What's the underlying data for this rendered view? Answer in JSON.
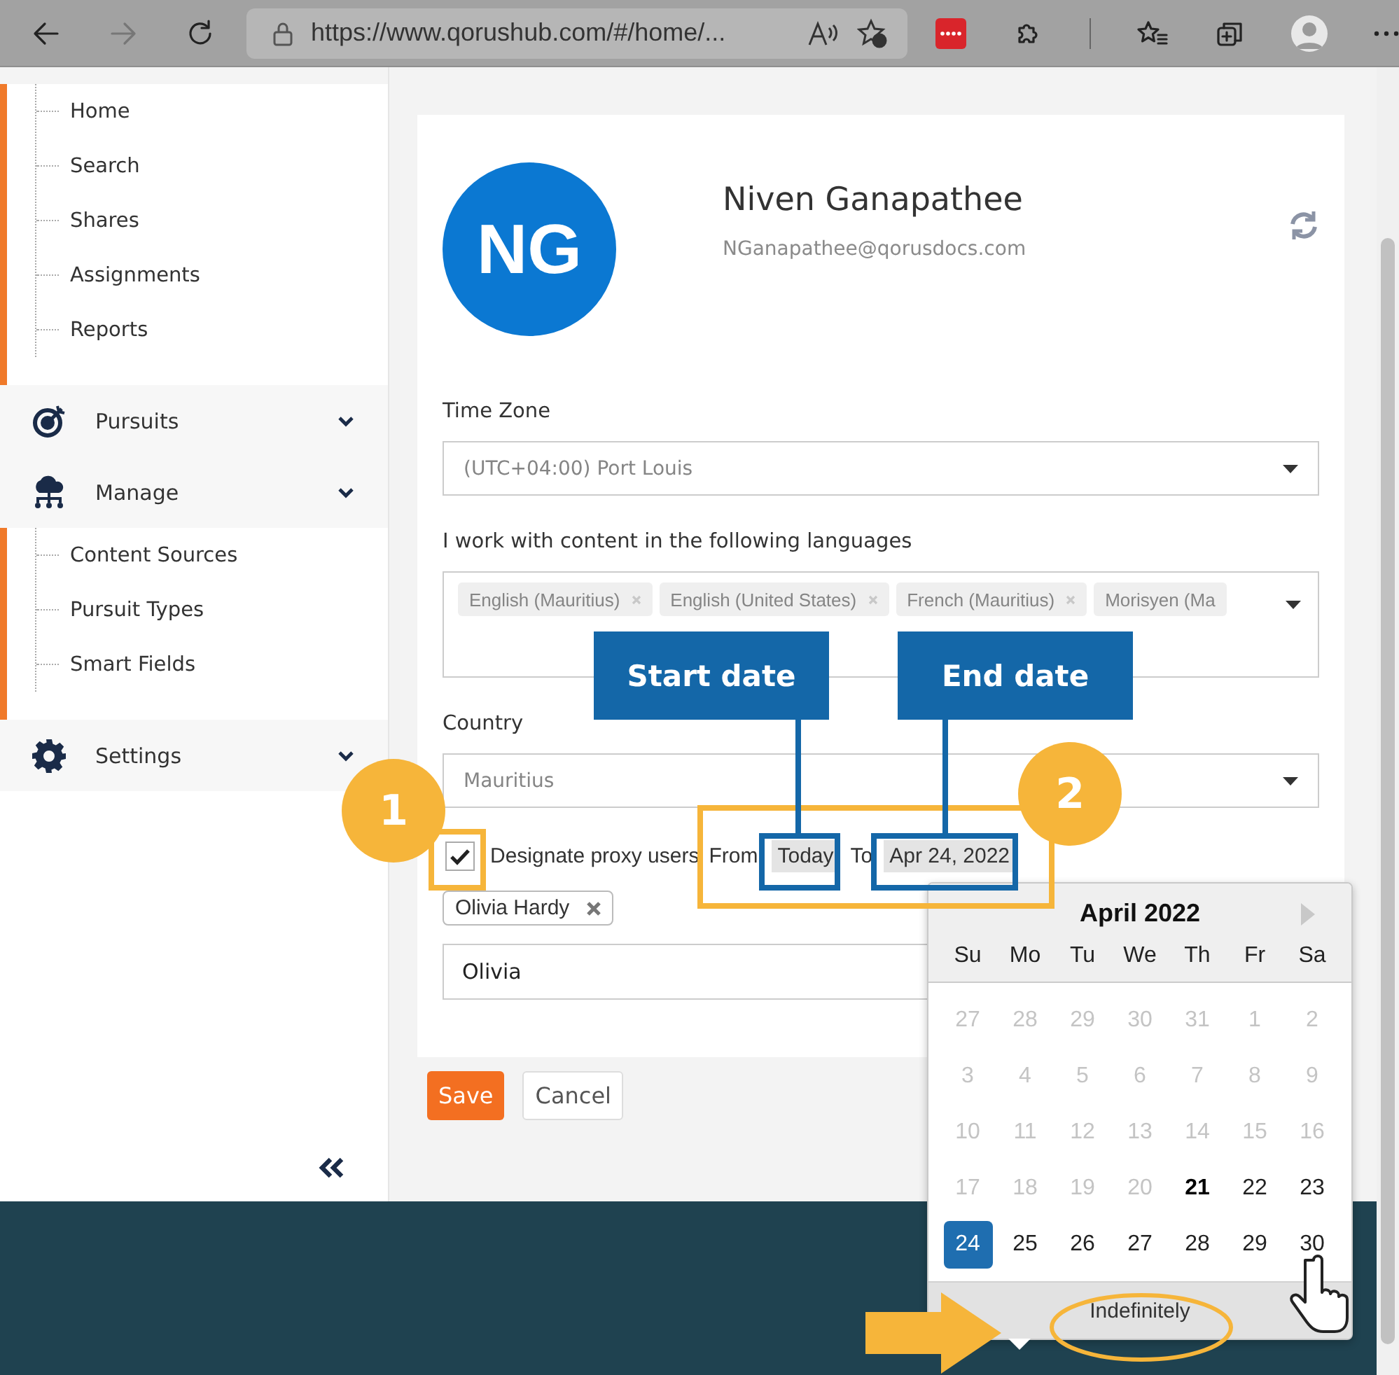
{
  "browser": {
    "url": "https://www.qorushub.com/#/home/..."
  },
  "sidebar": {
    "items": [
      {
        "kind": "links",
        "children": [
          {
            "label": "Home"
          },
          {
            "label": "Search"
          },
          {
            "label": "Shares"
          },
          {
            "label": "Assignments"
          },
          {
            "label": "Reports"
          }
        ]
      },
      {
        "kind": "group",
        "label": "Pursuits"
      },
      {
        "kind": "group",
        "label": "Manage"
      },
      {
        "kind": "links",
        "children": [
          {
            "label": "Content Sources"
          },
          {
            "label": "Pursuit Types"
          },
          {
            "label": "Smart Fields"
          }
        ]
      },
      {
        "kind": "group",
        "label": "Settings"
      }
    ]
  },
  "profile": {
    "initials": "NG",
    "name": "Niven Ganapathee",
    "email": "NGanapathee@qorusdocs.com"
  },
  "form": {
    "time_zone": {
      "label": "Time Zone",
      "value": "(UTC+04:00) Port Louis"
    },
    "languages": {
      "label": "I work with content in the following languages",
      "tags": [
        "English (Mauritius)",
        "English (United States)",
        "French (Mauritius)",
        "Morisyen (Ma"
      ]
    },
    "country": {
      "label": "Country",
      "value": "Mauritius"
    },
    "proxy": {
      "checked": true,
      "label": "Designate proxy users",
      "from_label": "From",
      "from_value": "Today",
      "to_label": "To",
      "to_value": "Apr 24, 2022",
      "users": [
        "Olivia Hardy"
      ],
      "search_value": "Olivia"
    }
  },
  "buttons": [
    {
      "label": "Save",
      "kind": "primary"
    },
    {
      "label": "Cancel",
      "kind": "secondary"
    }
  ],
  "calendar": {
    "title": "April 2022",
    "weekdays": [
      "Su",
      "Mo",
      "Tu",
      "We",
      "Th",
      "Fr",
      "Sa"
    ],
    "weeks": [
      [
        {
          "day": "27",
          "disabled": true,
          "today": false,
          "selected": false
        },
        {
          "day": "28",
          "disabled": true,
          "today": false,
          "selected": false
        },
        {
          "day": "29",
          "disabled": true,
          "today": false,
          "selected": false
        },
        {
          "day": "30",
          "disabled": true,
          "today": false,
          "selected": false
        },
        {
          "day": "31",
          "disabled": true,
          "today": false,
          "selected": false
        },
        {
          "day": "1",
          "disabled": true,
          "today": false,
          "selected": false
        },
        {
          "day": "2",
          "disabled": true,
          "today": false,
          "selected": false
        }
      ],
      [
        {
          "day": "3",
          "disabled": true,
          "today": false,
          "selected": false
        },
        {
          "day": "4",
          "disabled": true,
          "today": false,
          "selected": false
        },
        {
          "day": "5",
          "disabled": true,
          "today": false,
          "selected": false
        },
        {
          "day": "6",
          "disabled": true,
          "today": false,
          "selected": false
        },
        {
          "day": "7",
          "disabled": true,
          "today": false,
          "selected": false
        },
        {
          "day": "8",
          "disabled": true,
          "today": false,
          "selected": false
        },
        {
          "day": "9",
          "disabled": true,
          "today": false,
          "selected": false
        }
      ],
      [
        {
          "day": "10",
          "disabled": true,
          "today": false,
          "selected": false
        },
        {
          "day": "11",
          "disabled": true,
          "today": false,
          "selected": false
        },
        {
          "day": "12",
          "disabled": true,
          "today": false,
          "selected": false
        },
        {
          "day": "13",
          "disabled": true,
          "today": false,
          "selected": false
        },
        {
          "day": "14",
          "disabled": true,
          "today": false,
          "selected": false
        },
        {
          "day": "15",
          "disabled": true,
          "today": false,
          "selected": false
        },
        {
          "day": "16",
          "disabled": true,
          "today": false,
          "selected": false
        }
      ],
      [
        {
          "day": "17",
          "disabled": true,
          "today": false,
          "selected": false
        },
        {
          "day": "18",
          "disabled": true,
          "today": false,
          "selected": false
        },
        {
          "day": "19",
          "disabled": true,
          "today": false,
          "selected": false
        },
        {
          "day": "20",
          "disabled": true,
          "today": false,
          "selected": false
        },
        {
          "day": "21",
          "disabled": false,
          "today": true,
          "selected": false
        },
        {
          "day": "22",
          "disabled": false,
          "today": false,
          "selected": false
        },
        {
          "day": "23",
          "disabled": false,
          "today": false,
          "selected": false
        }
      ],
      [
        {
          "day": "24",
          "disabled": false,
          "today": false,
          "selected": true
        },
        {
          "day": "25",
          "disabled": false,
          "today": false,
          "selected": false
        },
        {
          "day": "26",
          "disabled": false,
          "today": false,
          "selected": false
        },
        {
          "day": "27",
          "disabled": false,
          "today": false,
          "selected": false
        },
        {
          "day": "28",
          "disabled": false,
          "today": false,
          "selected": false
        },
        {
          "day": "29",
          "disabled": false,
          "today": false,
          "selected": false
        },
        {
          "day": "30",
          "disabled": false,
          "today": false,
          "selected": false
        }
      ]
    ],
    "footer_button": "Indefinitely"
  },
  "annotations": {
    "callouts": [
      "Start date",
      "End date"
    ],
    "steps": [
      "1",
      "2"
    ]
  }
}
